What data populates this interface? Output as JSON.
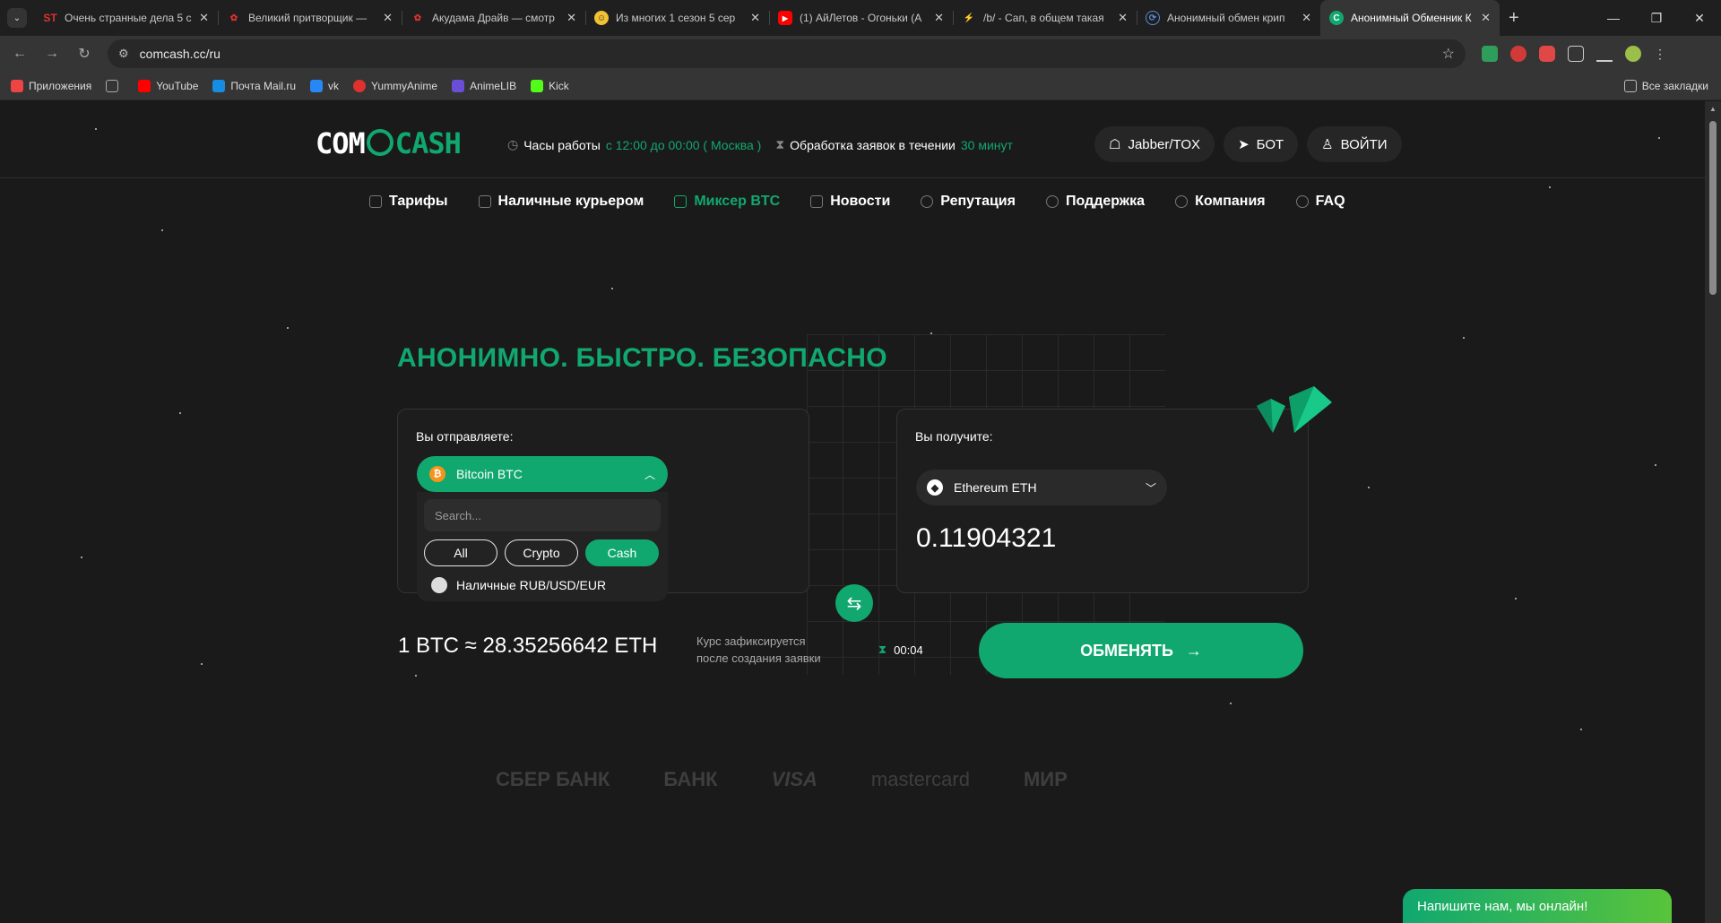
{
  "browser": {
    "tabs": [
      {
        "title": "Очень странные дела 5 с",
        "icon": "st-logo",
        "color": "#e0312f",
        "glyph": "ST"
      },
      {
        "title": "Великий притворщик —",
        "icon": "anime-icon",
        "color": "#e0312f",
        "glyph": "✿"
      },
      {
        "title": "Акудама Драйв — смотр",
        "icon": "anime-icon",
        "color": "#e0312f",
        "glyph": "✿"
      },
      {
        "title": "Из многих 1 сезон 5 сер",
        "icon": "smile-icon",
        "color": "#f1c232",
        "glyph": "☺"
      },
      {
        "title": "(1) АйЛетов - Огоньки (А",
        "icon": "youtube-icon",
        "color": "#ff0000",
        "glyph": "▶"
      },
      {
        "title": "/b/ - Сап, в общем такая",
        "icon": "bolt-icon",
        "color": "#f28c28",
        "glyph": "⚡"
      },
      {
        "title": "Анонимный обмен крип",
        "icon": "exchange-icon",
        "color": "#5a8dd6",
        "glyph": "⟳"
      },
      {
        "title": "Анонимный Обменник К",
        "icon": "comcash-icon",
        "color": "#11a870",
        "glyph": "C"
      }
    ],
    "url": "comcash.cc/ru",
    "bookmarks": [
      {
        "label": "Приложения",
        "color": "#e44"
      },
      {
        "label": "",
        "color": "#999"
      },
      {
        "label": "YouTube",
        "color": "#ff0000"
      },
      {
        "label": "Почта Mail.ru",
        "color": "#168de2"
      },
      {
        "label": "vk",
        "color": "#2787f5"
      },
      {
        "label": "YummyAnime",
        "color": "#e0312f"
      },
      {
        "label": "AnimeLIB",
        "color": "#6b4ed8"
      },
      {
        "label": "Kick",
        "color": "#53fc18"
      }
    ],
    "all_bookmarks": "Все закладки"
  },
  "header": {
    "logo_left": "COM",
    "logo_right": "CASH",
    "hours_label": "Часы работы",
    "hours_value": "с 12:00 до 00:00 ( Москва )",
    "processing_label": "Обработка заявок в течении",
    "processing_value": "30 минут",
    "buttons": {
      "jabber": "Jabber/TOX",
      "bot": "БОТ",
      "login": "ВОЙТИ"
    }
  },
  "nav": {
    "items": [
      "Тарифы",
      "Наличные курьером",
      "Миксер BTC",
      "Новости",
      "Репутация",
      "Поддержка",
      "Компания",
      "FAQ"
    ],
    "active_index": 2
  },
  "hero": {
    "headline": "АНОНИМНО. БЫСТРО. БЕЗОПАСНО"
  },
  "exchange": {
    "send_label": "Вы отправляете:",
    "send_currency": "Bitcoin BTC",
    "search_placeholder": "Search...",
    "filters": [
      "All",
      "Crypto",
      "Cash"
    ],
    "active_filter": "Cash",
    "option": "Наличные RUB/USD/EUR",
    "receive_label": "Вы получите:",
    "receive_currency": "Ethereum ETH",
    "receive_amount": "0.11904321",
    "rate": "1 BTC ≈ 28.35256642 ETH",
    "fix_note_line1": "Курс зафиксируется",
    "fix_note_line2": "после создания заявки",
    "timer": "00:04",
    "exchange_button": "ОБМЕНЯТЬ"
  },
  "payments": [
    "СБЕР БАНК",
    "БАНК",
    "VISA",
    "mastercard",
    "МИР"
  ],
  "chat": {
    "label": "Напишите нам, мы онлайн!"
  },
  "colors": {
    "accent": "#11a870",
    "background": "#1a1a1a"
  }
}
